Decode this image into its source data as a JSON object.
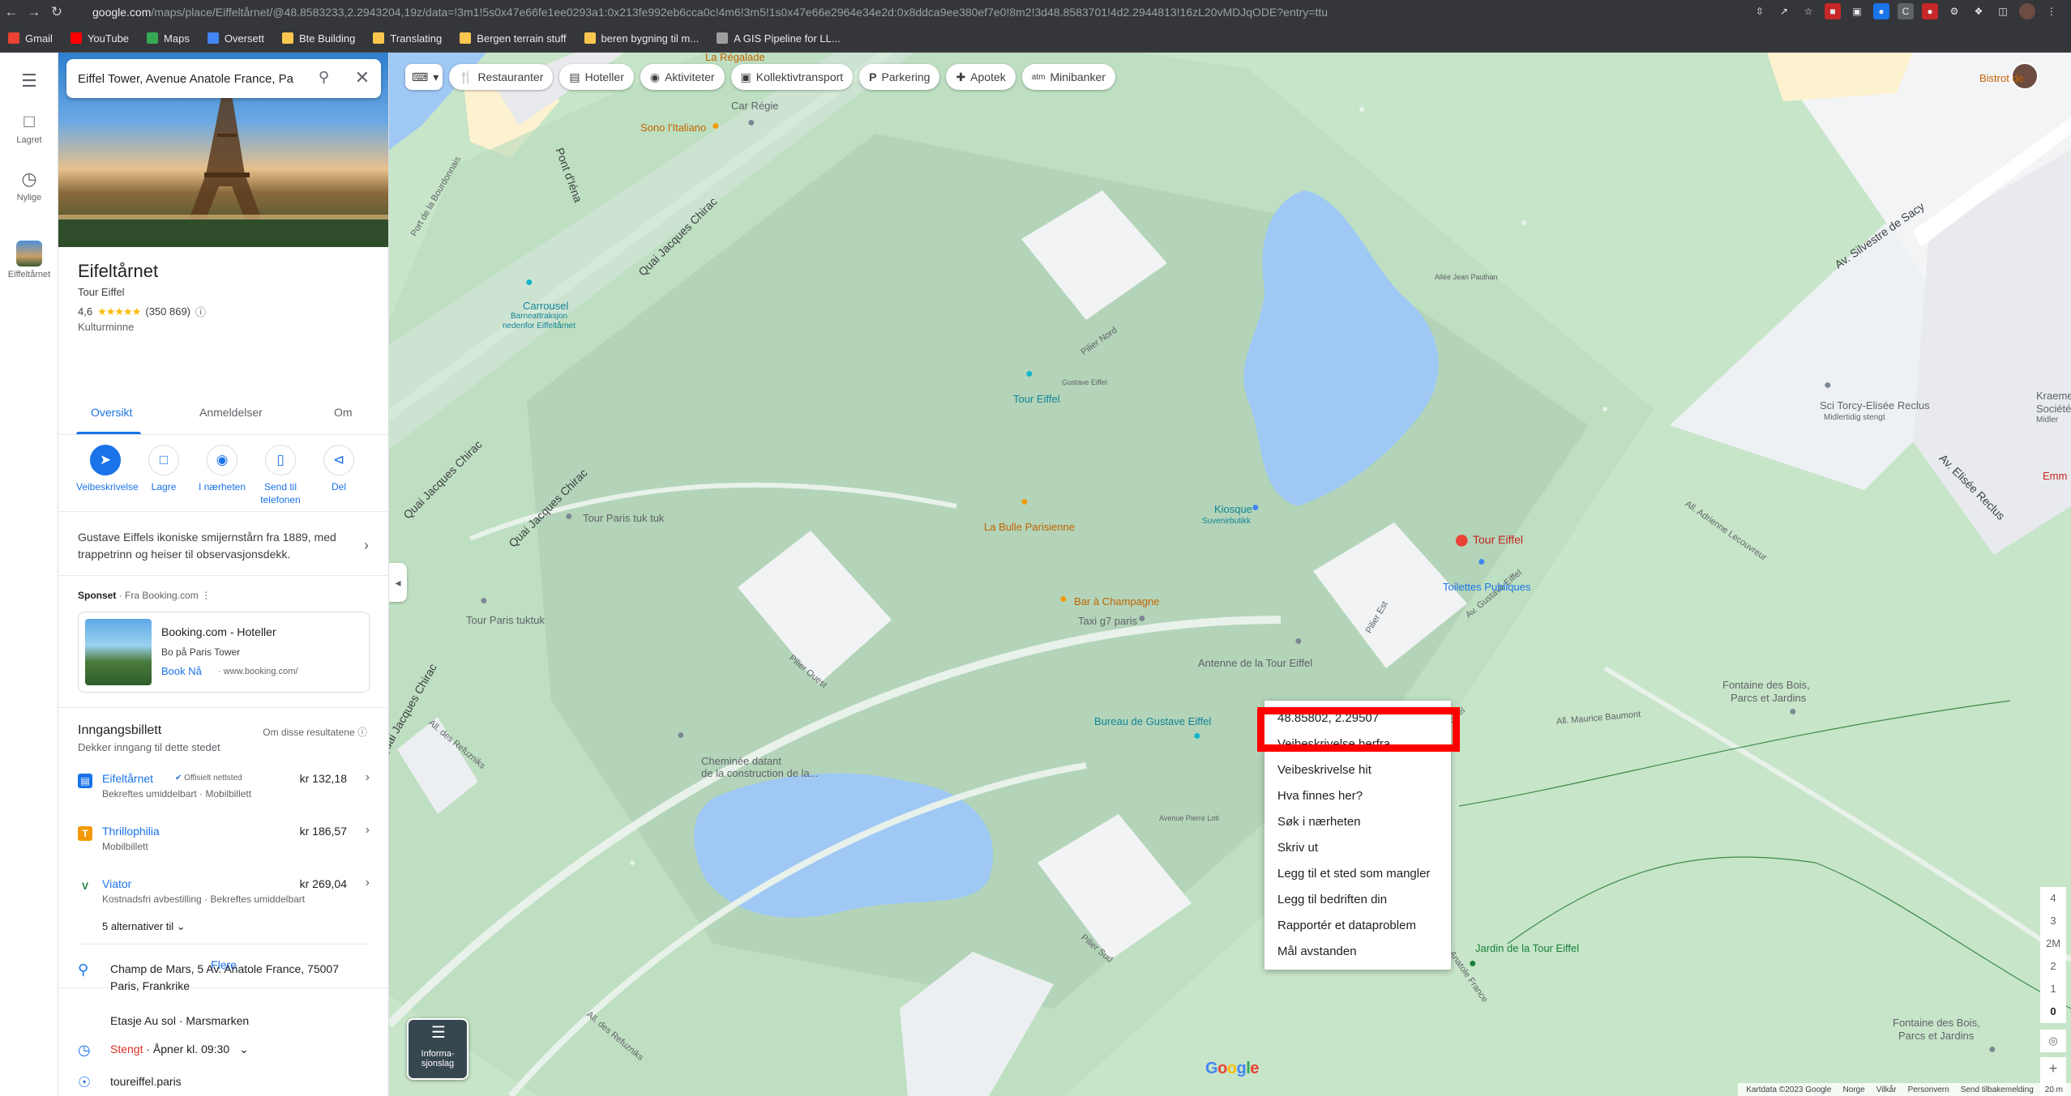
{
  "browser": {
    "url": "google.com/maps/place/Eiffeltårnet/@48.8583233,2.2943204,19z/data=!3m1!5s0x47e66fe1ee0293a1:0x213fe992eb6cca0c!4m6!3m5!1s0x47e66e2964e34e2d:0x8ddca9ee380ef7e0!8m2!3d48.8583701!4d2.2944813!16zL20vMDJqODE?entry=ttu",
    "url_host": "google.com"
  },
  "bookmarks": [
    {
      "label": "Gmail",
      "color": "#ea4335"
    },
    {
      "label": "YouTube",
      "color": "#ff0000"
    },
    {
      "label": "Maps",
      "color": "#34a853"
    },
    {
      "label": "Oversett",
      "color": "#4285f4"
    },
    {
      "label": "Bte Building",
      "color": "#f9c74f"
    },
    {
      "label": "Translating",
      "color": "#f9c74f"
    },
    {
      "label": "Bergen terrain stuff",
      "color": "#f9c74f"
    },
    {
      "label": "beren bygning til m...",
      "color": "#f9c74f"
    },
    {
      "label": "A GIS Pipeline for LL...",
      "color": "#9e9e9e"
    }
  ],
  "rail": {
    "menu_icon": "menu-icon",
    "saved": "Lagret",
    "recent": "Nylige",
    "place": "Eiffeltårnet"
  },
  "search": {
    "value": "Eiffel Tower, Avenue Anatole France, Pa"
  },
  "place": {
    "title": "Eifeltårnet",
    "subtitle": "Tour Eiffel",
    "rating": "4,6",
    "stars": "★★★★★",
    "reviews": "(350 869)",
    "category": "Kulturminne"
  },
  "tabs": [
    {
      "label": "Oversikt"
    },
    {
      "label": "Anmeldelser"
    },
    {
      "label": "Om"
    }
  ],
  "actions": [
    {
      "label": "Veibeskrivelse",
      "icon": "directions-icon"
    },
    {
      "label": "Lagre",
      "icon": "bookmark-icon"
    },
    {
      "label": "I nærheten",
      "icon": "nearby-icon"
    },
    {
      "label": "Send til telefonen",
      "icon": "phone-icon"
    },
    {
      "label": "Del",
      "icon": "share-icon"
    }
  ],
  "description": "Gustave Eiffels ikoniske smijernstårn fra 1889, med trappetrinn og heiser til observasjonsdekk.",
  "sponsored": {
    "label": "Sponset",
    "source": "· Fra Booking.com",
    "title": "Booking.com - Hoteller",
    "subtitle": "Bo på Paris Tower",
    "link": "Book Nå",
    "domain": "· www.booking.com/"
  },
  "tickets": {
    "title": "Inngangsbillett",
    "subtitle": "Dekker inngang til dette stedet",
    "note": "Om disse resultatene",
    "items": [
      {
        "name": "Eifeltårnet",
        "badge": "Offisielt nettsted",
        "detail": "Bekreftes umiddelbart · Mobilbillett",
        "price": "kr 132,18",
        "logo_color": "#1a73e8"
      },
      {
        "name": "Thrillophilia",
        "badge": "",
        "detail": "Mobilbillett",
        "price": "kr 186,57",
        "logo_color": "#f29900"
      },
      {
        "name": "Viator",
        "badge": "",
        "detail": "Kostnadsfri avbestilling · Bekreftes umiddelbart",
        "price": "kr 269,04",
        "logo_color": "#188038"
      }
    ],
    "more_options": "5 alternativer til",
    "more_button": "Flere"
  },
  "info": {
    "address_line1": "Champ de Mars, 5 Av. Anatole France, 75007",
    "address_line2": "Paris, Frankrike",
    "floor": "Etasje Au sol · Marsmarken",
    "status_closed": "Stengt",
    "status_open": "· Åpner kl. 09:30",
    "website": "toureiffel.paris"
  },
  "chips": [
    {
      "label": "Restauranter",
      "icon": "fork-knife-icon"
    },
    {
      "label": "Hoteller",
      "icon": "bed-icon"
    },
    {
      "label": "Aktiviteter",
      "icon": "camera-icon"
    },
    {
      "label": "Kollektivtransport",
      "icon": "bus-icon"
    },
    {
      "label": "Parkering",
      "icon": "parking-icon"
    },
    {
      "label": "Apotek",
      "icon": "pharmacy-icon"
    },
    {
      "label": "Minibanker",
      "icon": "atm-icon"
    }
  ],
  "map_labels": {
    "tour_eiffel_center": "Tour Eiffel",
    "tour_eiffel_north": "Tour Eiffel",
    "la_bulle": "La Bulle Parisienne",
    "bar_champagne": "Bar à Champagne",
    "taxi": "Taxi g7 paris",
    "kiosque": "Kiosque",
    "kiosque_sub": "Suvenirbutikk",
    "antenne": "Antenne de la Tour Eiffel",
    "toilettes": "Toilettes Publiques",
    "bureau": "Bureau de Gustave Eiffel",
    "carrousel": "Carrousel",
    "carrousel_sub1": "Barneattraksjon",
    "carrousel_sub2": "nedenfor Eiffeltårnet",
    "tuk1": "Tour Paris tuk tuk",
    "tuk2": "Tour Paris tuktuk",
    "car_regie": "Car Régie",
    "sono": "Sono l'Italiano",
    "la_regalade": "La Régalade",
    "cheminee1": "Cheminée datant",
    "cheminee2": "de la construction de la...",
    "fontaine1_a": "Fontaine des Bois,",
    "fontaine1_b": "Parcs et Jardins",
    "fontaine2_a": "Fontaine des Bois,",
    "fontaine2_b": "Parcs et Jardins",
    "jardin": "Jardin de la Tour Eiffel",
    "sci": "Sci Torcy-Elisée Reclus",
    "sci_sub": "Midlertidig stengt",
    "bistrot": "Bistrot de",
    "kraemer": "Kraeme",
    "societe": "Société",
    "mid": "Midler",
    "emm": "Emm",
    "pilier_nord": "Pilier Nord",
    "pilier_ouest": "Pilier Ouest",
    "pilier_est": "Pilier Est",
    "pilier_sud": "Pilier Sud",
    "gustave_eiffel": "Gustave Eiffel"
  },
  "streets": {
    "quai1": "Quai Jacques Chirac",
    "quai2": "Quai Jacques Chirac",
    "quai3": "Quai Jacques Chirac",
    "quai4": "Quai Jacques Chirac",
    "pont": "Pont d'Iéna",
    "silvestre": "Av. Silvestre de Sacy",
    "elisee": "Av. Elisée Reclus",
    "gustave": "Av. Gustave Eiffel",
    "anatole": "Av. Anatole France",
    "maurice": "All. Maurice Baumont",
    "adrienne": "All. Adrienne Lecouvreur",
    "refuzniks": "All. des Refuzniks",
    "pierre_loti": "Avenue Pierre Loti",
    "jean_paulhan": "Allée Jean Paulhan",
    "pont_bourdonnais": "Port de la Bourdonnais"
  },
  "context_menu": {
    "coordinates": "48.85802, 2.29507",
    "items": [
      "Veibeskrivelse herfra",
      "Veibeskrivelse hit",
      "Hva finnes her?",
      "Søk i nærheten",
      "Skriv ut",
      "Legg til et sted som mangler",
      "Legg til bedriften din",
      "Rapportér et dataproblem",
      "Mål avstanden"
    ]
  },
  "layers": {
    "label": "Informa-sjonslag"
  },
  "zoom_levels": [
    "4",
    "3",
    "2M",
    "2",
    "1",
    "0"
  ],
  "footer": {
    "mapdata": "Kartdata ©2023 Google",
    "country": "Norge",
    "terms": "Vilkår",
    "privacy": "Personvern",
    "feedback": "Send tilbakemelding",
    "scale": "20 m"
  },
  "colors": {
    "accent": "#1a73e8",
    "park": "#c7e5c9",
    "water": "#9fc8f5",
    "highlight": "#ff0000"
  }
}
